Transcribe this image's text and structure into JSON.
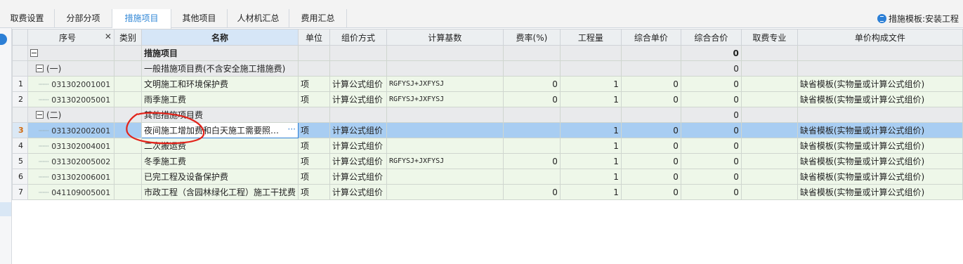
{
  "tabs": [
    {
      "label": "取费设置",
      "active": false
    },
    {
      "label": "分部分项",
      "active": false
    },
    {
      "label": "措施项目",
      "active": true
    },
    {
      "label": "其他项目",
      "active": false
    },
    {
      "label": "人材机汇总",
      "active": false
    },
    {
      "label": "费用汇总",
      "active": false
    }
  ],
  "template": {
    "label": "措施模板:安装工程",
    "icon": "document-icon"
  },
  "columns": [
    "序号",
    "类别",
    "名称",
    "单位",
    "组价方式",
    "计算基数",
    "费率(%)",
    "工程量",
    "综合单价",
    "综合合价",
    "取费专业",
    "单价构成文件"
  ],
  "rows": [
    {
      "rn": "",
      "code": "",
      "type": "",
      "name": "措施项目",
      "unit": "",
      "method": "",
      "base": "",
      "rate": "",
      "qty": "",
      "price": "",
      "total": "0",
      "spec": "",
      "file": "",
      "kind": "root"
    },
    {
      "rn": "",
      "code": "(一)",
      "type": "",
      "name": "一般措施项目费(不含安全施工措施费)",
      "unit": "",
      "method": "",
      "base": "",
      "rate": "",
      "qty": "",
      "price": "",
      "total": "0",
      "spec": "",
      "file": "",
      "kind": "grp"
    },
    {
      "rn": "1",
      "code": "031302001001",
      "type": "",
      "name": "文明施工和环境保护费",
      "unit": "项",
      "method": "计算公式组价",
      "base": "RGFYSJ+JXFYSJ",
      "rate": "0",
      "qty": "1",
      "price": "0",
      "total": "0",
      "spec": "",
      "file": "缺省模板(实物量或计算公式组价)",
      "kind": "item"
    },
    {
      "rn": "2",
      "code": "031302005001",
      "type": "",
      "name": "雨季施工费",
      "unit": "项",
      "method": "计算公式组价",
      "base": "RGFYSJ+JXFYSJ",
      "rate": "0",
      "qty": "1",
      "price": "0",
      "total": "0",
      "spec": "",
      "file": "缺省模板(实物量或计算公式组价)",
      "kind": "item"
    },
    {
      "rn": "",
      "code": "(二)",
      "type": "",
      "name": "其他措施项目费",
      "unit": "",
      "method": "",
      "base": "",
      "rate": "",
      "qty": "",
      "price": "",
      "total": "0",
      "spec": "",
      "file": "",
      "kind": "grp"
    },
    {
      "rn": "3",
      "code": "031302002001",
      "type": "",
      "name": "夜间施工增加费和白天施工需要照…",
      "unit": "项",
      "method": "计算公式组价",
      "base": "",
      "rate": "",
      "qty": "1",
      "price": "0",
      "total": "0",
      "spec": "",
      "file": "缺省模板(实物量或计算公式组价)",
      "kind": "cur"
    },
    {
      "rn": "4",
      "code": "031302004001",
      "type": "",
      "name": "二次搬运费",
      "unit": "项",
      "method": "计算公式组价",
      "base": "",
      "rate": "",
      "qty": "1",
      "price": "0",
      "total": "0",
      "spec": "",
      "file": "缺省模板(实物量或计算公式组价)",
      "kind": "item"
    },
    {
      "rn": "5",
      "code": "031302005002",
      "type": "",
      "name": "冬季施工费",
      "unit": "项",
      "method": "计算公式组价",
      "base": "RGFYSJ+JXFYSJ",
      "rate": "0",
      "qty": "1",
      "price": "0",
      "total": "0",
      "spec": "",
      "file": "缺省模板(实物量或计算公式组价)",
      "kind": "item"
    },
    {
      "rn": "6",
      "code": "031302006001",
      "type": "",
      "name": "已完工程及设备保护费",
      "unit": "项",
      "method": "计算公式组价",
      "base": "",
      "rate": "",
      "qty": "1",
      "price": "0",
      "total": "0",
      "spec": "",
      "file": "缺省模板(实物量或计算公式组价)",
      "kind": "item"
    },
    {
      "rn": "7",
      "code": "041109005001",
      "type": "",
      "name": "市政工程（含园林绿化工程）施工干扰费",
      "unit": "项",
      "method": "计算公式组价",
      "base": "",
      "rate": "0",
      "qty": "1",
      "price": "0",
      "total": "0",
      "spec": "",
      "file": "缺省模板(实物量或计算公式组价)",
      "kind": "item"
    }
  ],
  "colors": {
    "accent": "#2c7fd6",
    "selected_row": "#a8cdf2",
    "item_row": "#eef7e9",
    "annotation": "#e2231a"
  }
}
